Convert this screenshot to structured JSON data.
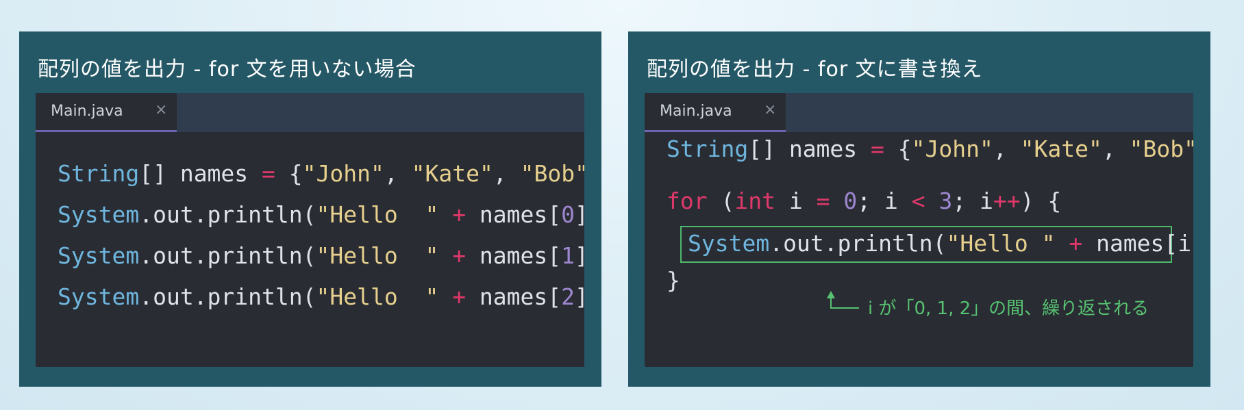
{
  "panels": [
    {
      "title": "配列の値を出力 - for 文を用いない場合",
      "tab": {
        "label": "Main.java",
        "close": "×"
      },
      "code": {
        "line1": {
          "type": "String",
          "a": "[] names ",
          "eq": "=",
          "b": " {",
          "s1": "\"John\"",
          "c1": ", ",
          "s2": "\"Kate\"",
          "c2": ", ",
          "s3": "\"Bob\"",
          "end": "};"
        },
        "lines": [
          {
            "type": "System",
            "a": ".out.println(",
            "str": "\"Hello  \"",
            "sp": " ",
            "op": "+",
            "b": " names[",
            "num": "0",
            "end": "]);"
          },
          {
            "type": "System",
            "a": ".out.println(",
            "str": "\"Hello  \"",
            "sp": " ",
            "op": "+",
            "b": " names[",
            "num": "1",
            "end": "]);"
          },
          {
            "type": "System",
            "a": ".out.println(",
            "str": "\"Hello  \"",
            "sp": " ",
            "op": "+",
            "b": " names[",
            "num": "2",
            "end": "]);"
          }
        ]
      }
    },
    {
      "title": "配列の値を出力 - for 文に書き換え",
      "tab": {
        "label": "Main.java",
        "close": "×"
      },
      "code": {
        "line1": {
          "type": "String",
          "a": "[] names ",
          "eq": "=",
          "b": " {",
          "s1": "\"John\"",
          "c1": ", ",
          "s2": "\"Kate\"",
          "c2": ", ",
          "s3": "\"Bob\"",
          "end": "};"
        },
        "for_line": {
          "kw": "for",
          "p1": " (",
          "int": "int",
          "p2": " i ",
          "eq": "=",
          "sp": " ",
          "zero": "0",
          "p3": "; i ",
          "lt": "<",
          "sp2": " ",
          "three": "3",
          "p4": "; i",
          "inc": "++",
          "p5": ") {"
        },
        "body": {
          "type": "System",
          "a": ".out.println(",
          "str": "\"Hello \"",
          "sp": " ",
          "op": "+",
          "b": " names[i]);"
        },
        "close": "}"
      },
      "annotation": "i が「0, 1, 2」の間、繰り返される"
    }
  ],
  "colors": {
    "panel_bg": "#255866",
    "editor_bg": "#292d33",
    "type": "#6fb6df",
    "string": "#e7d08e",
    "operator": "#e0386a",
    "number": "#9e86cf",
    "annotation": "#57c271"
  }
}
